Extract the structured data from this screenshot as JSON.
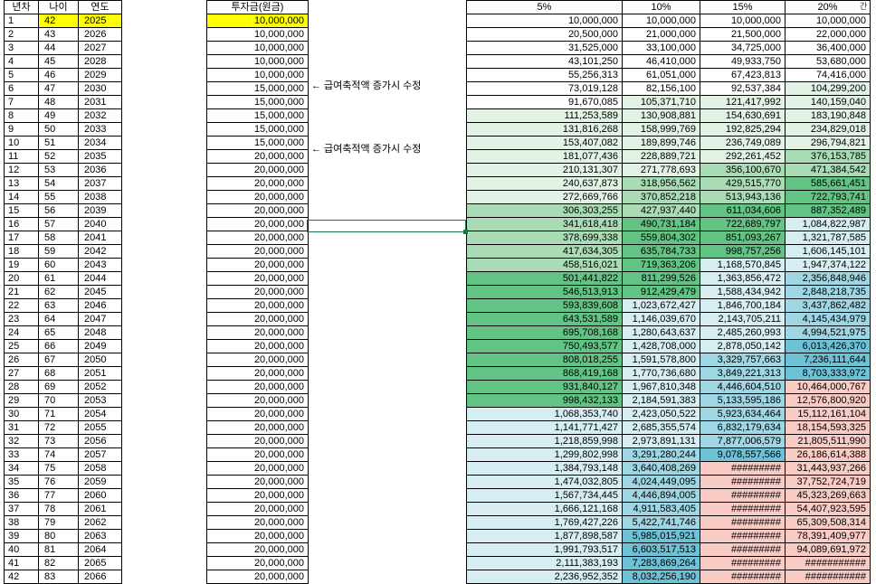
{
  "headers": {
    "num": "년차",
    "age": "나이",
    "year": "연도",
    "invest": "투자금(원금)",
    "rates": [
      "5%",
      "10%",
      "15%",
      "20%"
    ]
  },
  "corner_label": "간",
  "notes": [
    {
      "row": 6,
      "text": "← 급여축적액 증가시 수정"
    },
    {
      "row": 11,
      "text": "← 급여축적액 증가시 수정"
    }
  ],
  "colors": {
    "green_light": "#e2f3e5",
    "green_mid": "#a9dcb4",
    "green_dark": "#63c384",
    "blue_light": "#d6eef2",
    "blue_mid": "#9fd6e3",
    "blue_dark": "#6fc1d6",
    "pink": "#f8cbc4",
    "highlight": "#ffff00",
    "selection": "#217346"
  },
  "rows": [
    {
      "n": "1",
      "age": "42",
      "year": "2025",
      "inv": "10,000,000",
      "v": [
        "10,000,000",
        "10,000,000",
        "10,000,000",
        "10,000,000"
      ],
      "s": [
        "",
        "",
        "",
        ""
      ]
    },
    {
      "n": "2",
      "age": "43",
      "year": "2026",
      "inv": "10,000,000",
      "v": [
        "20,500,000",
        "21,000,000",
        "21,500,000",
        "22,000,000"
      ],
      "s": [
        "",
        "",
        "",
        ""
      ]
    },
    {
      "n": "3",
      "age": "44",
      "year": "2027",
      "inv": "10,000,000",
      "v": [
        "31,525,000",
        "33,100,000",
        "34,725,000",
        "36,400,000"
      ],
      "s": [
        "",
        "",
        "",
        ""
      ]
    },
    {
      "n": "4",
      "age": "45",
      "year": "2028",
      "inv": "10,000,000",
      "v": [
        "43,101,250",
        "46,410,000",
        "49,933,750",
        "53,680,000"
      ],
      "s": [
        "",
        "",
        "",
        ""
      ]
    },
    {
      "n": "5",
      "age": "46",
      "year": "2029",
      "inv": "10,000,000",
      "v": [
        "55,256,313",
        "61,051,000",
        "67,423,813",
        "74,416,000"
      ],
      "s": [
        "",
        "",
        "",
        ""
      ]
    },
    {
      "n": "6",
      "age": "47",
      "year": "2030",
      "inv": "15,000,000",
      "v": [
        "73,019,128",
        "82,156,100",
        "92,537,384",
        "104,299,200"
      ],
      "s": [
        "",
        "",
        "",
        "g1"
      ]
    },
    {
      "n": "7",
      "age": "48",
      "year": "2031",
      "inv": "15,000,000",
      "v": [
        "91,670,085",
        "105,371,710",
        "121,417,992",
        "140,159,040"
      ],
      "s": [
        "",
        "g1",
        "g1",
        "g1"
      ]
    },
    {
      "n": "8",
      "age": "49",
      "year": "2032",
      "inv": "15,000,000",
      "v": [
        "111,253,589",
        "130,908,881",
        "154,630,691",
        "183,190,848"
      ],
      "s": [
        "g1",
        "g1",
        "g1",
        "g1"
      ]
    },
    {
      "n": "9",
      "age": "50",
      "year": "2033",
      "inv": "15,000,000",
      "v": [
        "131,816,268",
        "158,999,769",
        "192,825,294",
        "234,829,018"
      ],
      "s": [
        "g1",
        "g1",
        "g1",
        "g1"
      ]
    },
    {
      "n": "10",
      "age": "51",
      "year": "2034",
      "inv": "15,000,000",
      "v": [
        "153,407,082",
        "189,899,746",
        "236,749,089",
        "296,794,821"
      ],
      "s": [
        "g1",
        "g1",
        "g1",
        "g1"
      ]
    },
    {
      "n": "11",
      "age": "52",
      "year": "2035",
      "inv": "20,000,000",
      "v": [
        "181,077,436",
        "228,889,721",
        "292,261,452",
        "376,153,785"
      ],
      "s": [
        "g1",
        "g1",
        "g1",
        "g2"
      ]
    },
    {
      "n": "12",
      "age": "53",
      "year": "2036",
      "inv": "20,000,000",
      "v": [
        "210,131,307",
        "271,778,693",
        "356,100,670",
        "471,384,542"
      ],
      "s": [
        "g1",
        "g1",
        "g2",
        "g2"
      ]
    },
    {
      "n": "13",
      "age": "54",
      "year": "2037",
      "inv": "20,000,000",
      "v": [
        "240,637,873",
        "318,956,562",
        "429,515,770",
        "585,661,451"
      ],
      "s": [
        "g1",
        "g2",
        "g2",
        "g3"
      ]
    },
    {
      "n": "14",
      "age": "55",
      "year": "2038",
      "inv": "20,000,000",
      "v": [
        "272,669,766",
        "370,852,218",
        "513,943,136",
        "722,793,741"
      ],
      "s": [
        "g1",
        "g2",
        "g2",
        "g3"
      ]
    },
    {
      "n": "15",
      "age": "56",
      "year": "2039",
      "inv": "20,000,000",
      "v": [
        "306,303,255",
        "427,937,440",
        "611,034,606",
        "887,352,489"
      ],
      "s": [
        "g2",
        "g2",
        "g3",
        "g3"
      ]
    },
    {
      "n": "16",
      "age": "57",
      "year": "2040",
      "inv": "20,000,000",
      "v": [
        "341,618,418",
        "490,731,184",
        "722,689,797",
        "1,084,822,987"
      ],
      "s": [
        "g2",
        "g3",
        "g3",
        "b1"
      ]
    },
    {
      "n": "17",
      "age": "58",
      "year": "2041",
      "inv": "20,000,000",
      "v": [
        "378,699,338",
        "559,804,302",
        "851,093,267",
        "1,321,787,585"
      ],
      "s": [
        "g2",
        "g3",
        "g3",
        "b1"
      ]
    },
    {
      "n": "18",
      "age": "59",
      "year": "2042",
      "inv": "20,000,000",
      "v": [
        "417,634,305",
        "635,784,733",
        "998,757,256",
        "1,606,145,101"
      ],
      "s": [
        "g2",
        "g3",
        "g3",
        "b1"
      ]
    },
    {
      "n": "19",
      "age": "60",
      "year": "2043",
      "inv": "20,000,000",
      "v": [
        "458,516,021",
        "719,363,206",
        "1,168,570,845",
        "1,947,374,122"
      ],
      "s": [
        "g2",
        "g3",
        "b1",
        "b1"
      ]
    },
    {
      "n": "20",
      "age": "61",
      "year": "2044",
      "inv": "20,000,000",
      "v": [
        "501,441,822",
        "811,299,526",
        "1,363,856,472",
        "2,356,848,946"
      ],
      "s": [
        "g3",
        "g3",
        "b1",
        "b2"
      ]
    },
    {
      "n": "21",
      "age": "62",
      "year": "2045",
      "inv": "20,000,000",
      "v": [
        "546,513,913",
        "912,429,479",
        "1,588,434,942",
        "2,848,218,735"
      ],
      "s": [
        "g3",
        "g3",
        "b1",
        "b2"
      ]
    },
    {
      "n": "22",
      "age": "63",
      "year": "2046",
      "inv": "20,000,000",
      "v": [
        "593,839,608",
        "1,023,672,427",
        "1,846,700,184",
        "3,437,862,482"
      ],
      "s": [
        "g3",
        "b1",
        "b1",
        "b2"
      ]
    },
    {
      "n": "23",
      "age": "64",
      "year": "2047",
      "inv": "20,000,000",
      "v": [
        "643,531,589",
        "1,146,039,670",
        "2,143,705,211",
        "4,145,434,979"
      ],
      "s": [
        "g3",
        "b1",
        "b1",
        "b2"
      ]
    },
    {
      "n": "24",
      "age": "65",
      "year": "2048",
      "inv": "20,000,000",
      "v": [
        "695,708,168",
        "1,280,643,637",
        "2,485,260,993",
        "4,994,521,975"
      ],
      "s": [
        "g3",
        "b1",
        "b1",
        "b2"
      ]
    },
    {
      "n": "25",
      "age": "66",
      "year": "2049",
      "inv": "20,000,000",
      "v": [
        "750,493,577",
        "1,428,708,000",
        "2,878,050,142",
        "6,013,426,370"
      ],
      "s": [
        "g3",
        "b1",
        "b1",
        "b3"
      ]
    },
    {
      "n": "26",
      "age": "67",
      "year": "2050",
      "inv": "20,000,000",
      "v": [
        "808,018,255",
        "1,591,578,800",
        "3,329,757,663",
        "7,236,111,644"
      ],
      "s": [
        "g3",
        "b1",
        "b2",
        "b3"
      ]
    },
    {
      "n": "27",
      "age": "68",
      "year": "2051",
      "inv": "20,000,000",
      "v": [
        "868,419,168",
        "1,770,736,680",
        "3,849,221,313",
        "8,703,333,972"
      ],
      "s": [
        "g3",
        "b1",
        "b2",
        "b3"
      ]
    },
    {
      "n": "28",
      "age": "69",
      "year": "2052",
      "inv": "20,000,000",
      "v": [
        "931,840,127",
        "1,967,810,348",
        "4,446,604,510",
        "10,464,000,767"
      ],
      "s": [
        "g3",
        "b1",
        "b2",
        "p"
      ]
    },
    {
      "n": "29",
      "age": "70",
      "year": "2053",
      "inv": "20,000,000",
      "v": [
        "998,432,133",
        "2,184,591,383",
        "5,133,595,186",
        "12,576,800,920"
      ],
      "s": [
        "g3",
        "b1",
        "b2",
        "p"
      ]
    },
    {
      "n": "30",
      "age": "71",
      "year": "2054",
      "inv": "20,000,000",
      "v": [
        "1,068,353,740",
        "2,423,050,522",
        "5,923,634,464",
        "15,112,161,104"
      ],
      "s": [
        "b1",
        "b1",
        "b2",
        "p"
      ]
    },
    {
      "n": "31",
      "age": "72",
      "year": "2055",
      "inv": "20,000,000",
      "v": [
        "1,141,771,427",
        "2,685,355,574",
        "6,832,179,634",
        "18,154,593,325"
      ],
      "s": [
        "b1",
        "b1",
        "b2",
        "p"
      ]
    },
    {
      "n": "32",
      "age": "73",
      "year": "2056",
      "inv": "20,000,000",
      "v": [
        "1,218,859,998",
        "2,973,891,131",
        "7,877,006,579",
        "21,805,511,990"
      ],
      "s": [
        "b1",
        "b1",
        "b2",
        "p"
      ]
    },
    {
      "n": "33",
      "age": "74",
      "year": "2057",
      "inv": "20,000,000",
      "v": [
        "1,299,802,998",
        "3,291,280,244",
        "9,078,557,566",
        "26,186,614,388"
      ],
      "s": [
        "b1",
        "b2",
        "b3",
        "p"
      ]
    },
    {
      "n": "34",
      "age": "75",
      "year": "2058",
      "inv": "20,000,000",
      "v": [
        "1,384,793,148",
        "3,640,408,269",
        "#########",
        "31,443,937,266"
      ],
      "s": [
        "b1",
        "b2",
        "p",
        "p"
      ]
    },
    {
      "n": "35",
      "age": "76",
      "year": "2059",
      "inv": "20,000,000",
      "v": [
        "1,474,032,805",
        "4,024,449,095",
        "#########",
        "37,752,724,719"
      ],
      "s": [
        "b1",
        "b2",
        "p",
        "p"
      ]
    },
    {
      "n": "36",
      "age": "77",
      "year": "2060",
      "inv": "20,000,000",
      "v": [
        "1,567,734,445",
        "4,446,894,005",
        "#########",
        "45,323,269,663"
      ],
      "s": [
        "b1",
        "b2",
        "p",
        "p"
      ]
    },
    {
      "n": "37",
      "age": "78",
      "year": "2061",
      "inv": "20,000,000",
      "v": [
        "1,666,121,168",
        "4,911,583,405",
        "#########",
        "54,407,923,595"
      ],
      "s": [
        "b1",
        "b2",
        "p",
        "p"
      ]
    },
    {
      "n": "38",
      "age": "79",
      "year": "2062",
      "inv": "20,000,000",
      "v": [
        "1,769,427,226",
        "5,422,741,746",
        "#########",
        "65,309,508,314"
      ],
      "s": [
        "b1",
        "b2",
        "p",
        "p"
      ]
    },
    {
      "n": "39",
      "age": "80",
      "year": "2063",
      "inv": "20,000,000",
      "v": [
        "1,877,898,587",
        "5,985,015,921",
        "#########",
        "78,391,409,977"
      ],
      "s": [
        "b1",
        "b3",
        "p",
        "p"
      ]
    },
    {
      "n": "40",
      "age": "81",
      "year": "2064",
      "inv": "20,000,000",
      "v": [
        "1,991,793,517",
        "6,603,517,513",
        "#########",
        "94,089,691,972"
      ],
      "s": [
        "b1",
        "b3",
        "p",
        "p"
      ]
    },
    {
      "n": "41",
      "age": "82",
      "year": "2065",
      "inv": "20,000,000",
      "v": [
        "2,111,383,193",
        "7,283,869,264",
        "#########",
        "###########"
      ],
      "s": [
        "b1",
        "b3",
        "p",
        "p"
      ]
    },
    {
      "n": "42",
      "age": "83",
      "year": "2066",
      "inv": "20,000,000",
      "v": [
        "2,236,952,352",
        "8,032,256,190",
        "#########",
        "###########"
      ],
      "s": [
        "b1",
        "b3",
        "p",
        "p"
      ]
    }
  ]
}
